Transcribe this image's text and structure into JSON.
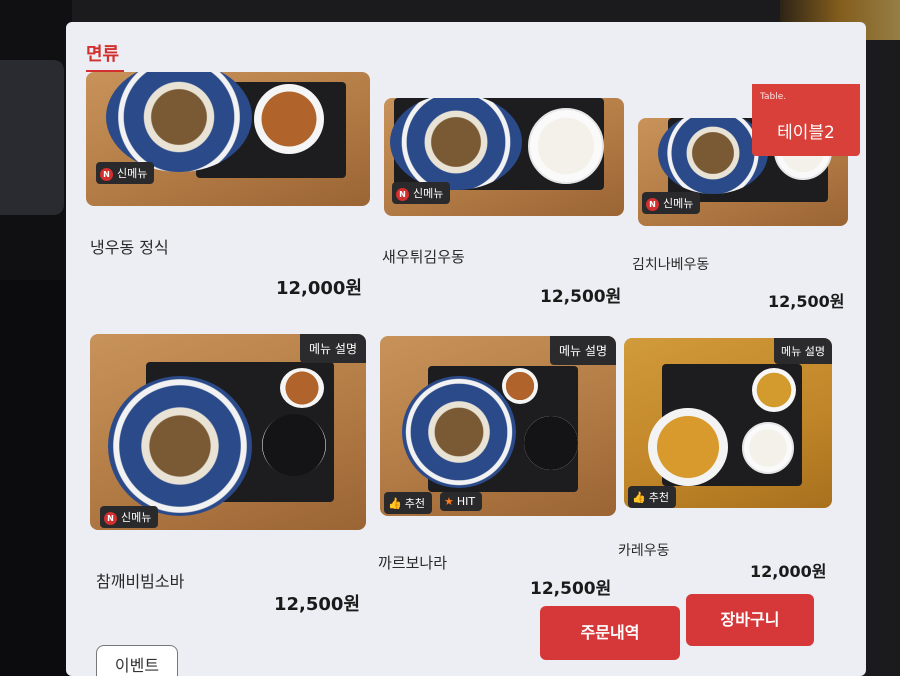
{
  "category": {
    "label": "면류"
  },
  "table_badge": {
    "small": "Table.",
    "label": "테이블2"
  },
  "menu": [
    {
      "name": "냉우동 정식",
      "price": "12,000원",
      "badges": [
        "신메뉴"
      ]
    },
    {
      "name": "새우튀김우동",
      "price": "12,500원",
      "badges": [
        "신메뉴"
      ]
    },
    {
      "name": "김치나베우동",
      "price": "12,500원",
      "badges": [
        "신메뉴"
      ]
    },
    {
      "name": "참깨비빔소바",
      "price": "12,500원",
      "desc_label": "메뉴 설명",
      "badges": [
        "신메뉴"
      ]
    },
    {
      "name": "까르보나라",
      "price": "12,500원",
      "desc_label": "메뉴 설명",
      "badges": [
        "추천",
        "HIT"
      ]
    },
    {
      "name": "카레우동",
      "price": "12,000원",
      "desc_label": "메뉴 설명",
      "badges": [
        "추천"
      ]
    }
  ],
  "buttons": {
    "order_history": "주문내역",
    "cart": "장바구니",
    "event": "이벤트"
  },
  "colors": {
    "accent": "#d6383a",
    "background": "#eceef3"
  }
}
